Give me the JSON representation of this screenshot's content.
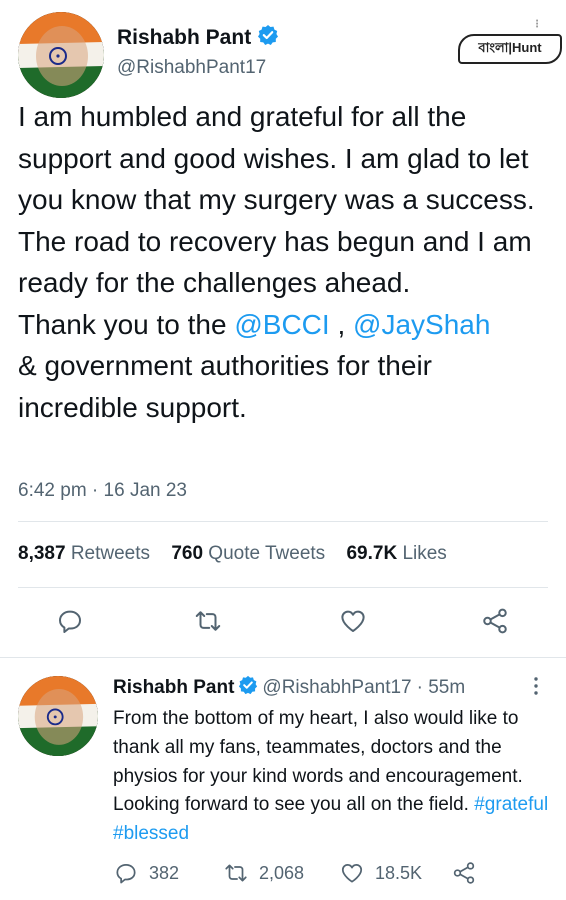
{
  "main_tweet": {
    "author_name": "Rishabh Pant",
    "handle": "@RishabhPant17",
    "text_parts": [
      "I am humbled and grateful for all the support and good wishes. I am glad to let you know that my surgery was a success. The road to recovery has begun and I am ready for the challenges ahead.",
      "Thank you to the ",
      "@BCCI",
      " , ",
      "@JaySha h",
      "& government authorities for their incredible support."
    ],
    "timestamp": "6:42 pm · 16 Jan 23",
    "stats": {
      "retweets_count": "8,387",
      "retweets_label": "Retweets",
      "quotes_count": "760",
      "quotes_label": "Quote Tweets",
      "likes_count": "69.7K",
      "likes_label": "Likes"
    }
  },
  "watermark": {
    "text": "বাংলা|Hunt"
  },
  "reply_tweet": {
    "author_name": "Rishabh Pant",
    "handle": "@RishabhPant17",
    "time_ago": "· 55m",
    "text_main": "From the bottom of my heart, I also would like to thank all my fans, teammates, doctors and the physios for your kind words and encouragement. Looking forward to see you all on the field.",
    "hashtag_1": "#grateful",
    "hashtag_2": "#blessed",
    "replies": "382",
    "retweets": "2,068",
    "likes": "18.5K"
  },
  "colors": {
    "link": "#1d9bf0",
    "secondary": "#536471",
    "text": "#0f1419",
    "divider": "#e1e6ea"
  },
  "icons": [
    "verified-badge-icon",
    "reply-icon",
    "retweet-icon",
    "like-icon",
    "share-icon",
    "more-icon"
  ]
}
